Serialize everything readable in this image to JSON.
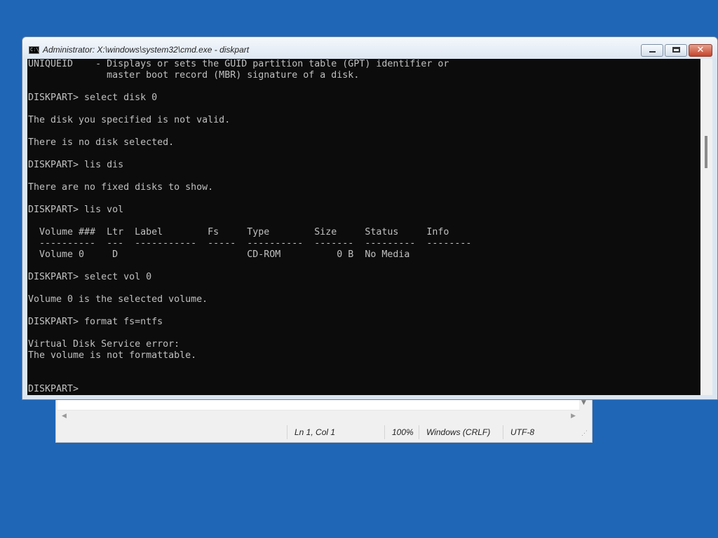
{
  "cmd_window": {
    "title": "Administrator: X:\\windows\\system32\\cmd.exe - diskpart",
    "icon_label": "C:\\",
    "controls": {
      "minimize": "",
      "maximize": "",
      "close": "✕"
    }
  },
  "console": {
    "lines": [
      "UNIQUEID    - Displays or sets the GUID partition table (GPT) identifier or",
      "              master boot record (MBR) signature of a disk.",
      "",
      "DISKPART> select disk 0",
      "",
      "The disk you specified is not valid.",
      "",
      "There is no disk selected.",
      "",
      "DISKPART> lis dis",
      "",
      "There are no fixed disks to show.",
      "",
      "DISKPART> lis vol",
      "",
      "  Volume ###  Ltr  Label        Fs     Type        Size     Status     Info",
      "  ----------  ---  -----------  -----  ----------  -------  ---------  --------",
      "  Volume 0     D                       CD-ROM          0 B  No Media",
      "",
      "DISKPART> select vol 0",
      "",
      "Volume 0 is the selected volume.",
      "",
      "DISKPART> format fs=ntfs",
      "",
      "Virtual Disk Service error:",
      "The volume is not formattable.",
      "",
      "",
      "DISKPART> "
    ]
  },
  "notepad": {
    "status": {
      "position": "Ln 1, Col 1",
      "zoom": "100%",
      "line_ending": "Windows (CRLF)",
      "encoding": "UTF-8"
    }
  },
  "colors": {
    "desktop": "#1f66b7",
    "console_bg": "#0c0c0c",
    "console_fg": "#c0c0c0"
  }
}
